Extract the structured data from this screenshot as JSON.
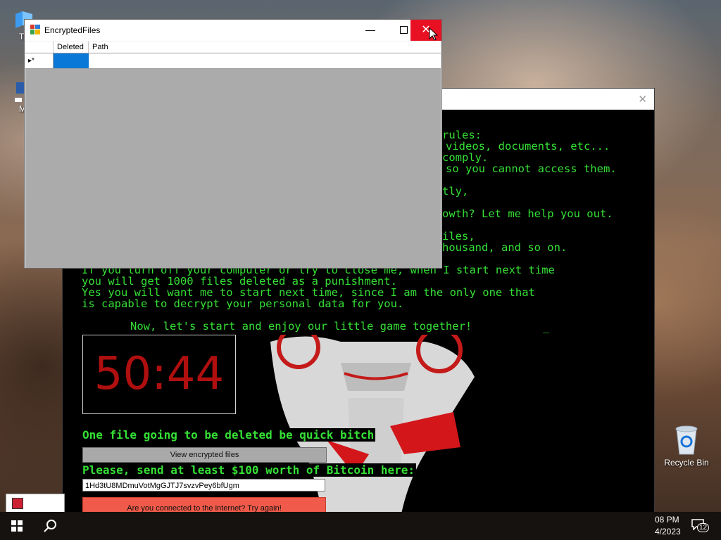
{
  "desktop": {
    "icons": [
      {
        "label": "Th",
        "icon": "folder-icon"
      },
      {
        "label": "M",
        "icon": "shortcut-icon"
      },
      {
        "label": "Recycle Bin",
        "icon": "recycle-bin-icon"
      }
    ]
  },
  "encrypted_files_window": {
    "title": "EncryptedFiles",
    "controls": {
      "minimize": "—",
      "close": "✕"
    },
    "grid": {
      "columns": [
        "Deleted",
        "Path"
      ],
      "new_row_marker": "▸*"
    }
  },
  "ransom_window": {
    "close": "✕",
    "text_lines": [
      "rules:",
      "videos, documents, etc...",
      "comply.",
      "so you cannot access them.",
      "tly,",
      "owth? Let me help you out.",
      "iles,",
      "housand, and so on.",
      "If you turn off your computer or try to close me, when I start next time",
      "you will get 1000 files deleted as a punishment.",
      "Yes you will want me to start next time, since I am the only one that",
      "is capable to decrypt your personal data for you.",
      "Now, let's start and enjoy our little game together!"
    ],
    "cursor": "_",
    "timer": "50:44",
    "warning": "One file going to be deleted be quick bitch",
    "view_button": "View encrypted files",
    "payment_prompt": "Please, send at least $100 worth of Bitcoin here:",
    "bitcoin_address": "1Hd3tU8MDmuVotMgGJTJ7svzvPey6bfUgm",
    "check_button": "Are you connected to the internet? Try again!"
  },
  "taskbar": {
    "clock_time": "08 PM",
    "clock_date": "4/2023",
    "notification_count": "12"
  }
}
